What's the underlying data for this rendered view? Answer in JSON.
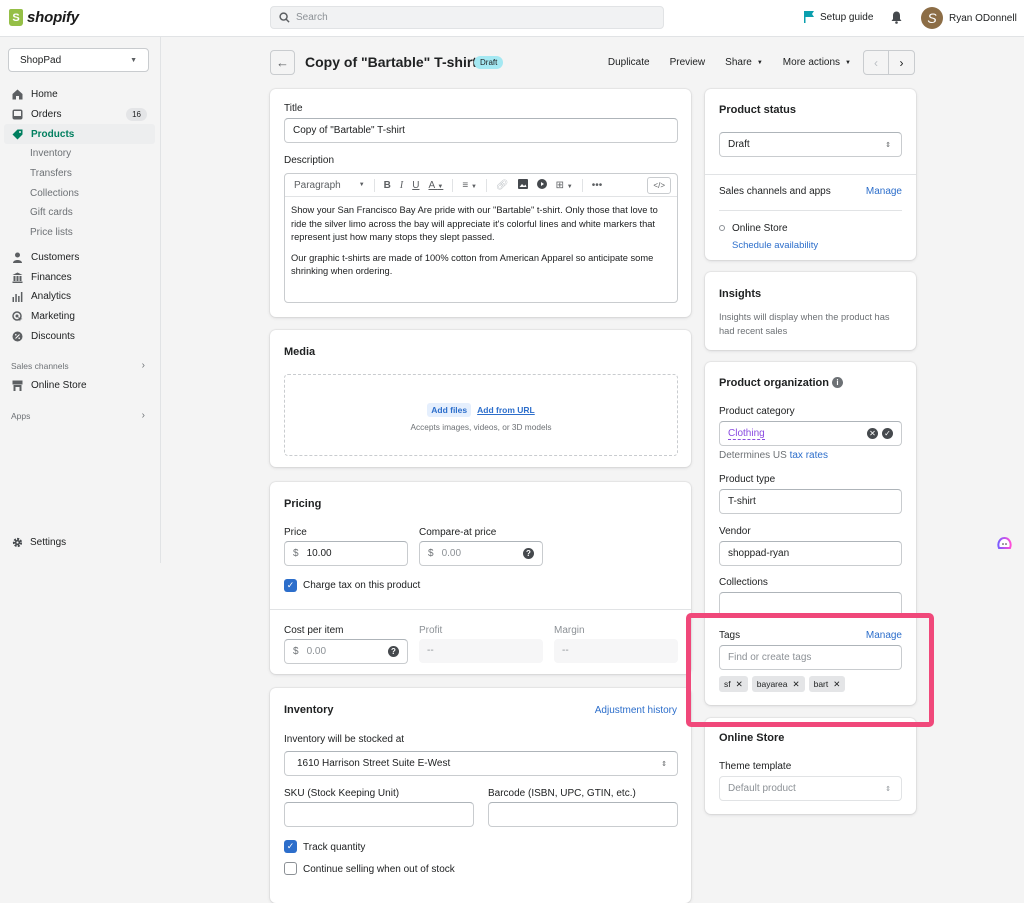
{
  "topbar": {
    "brand": "shopify",
    "search_placeholder": "Search",
    "setup_guide": "Setup guide",
    "user_initial": "S",
    "user_name": "Ryan ODonnell"
  },
  "sidebar": {
    "store_name": "ShopPad",
    "items": [
      {
        "label": "Home",
        "icon": "home-icon"
      },
      {
        "label": "Orders",
        "icon": "orders-icon",
        "badge": "16"
      },
      {
        "label": "Products",
        "icon": "tag-icon",
        "active": true
      }
    ],
    "product_sub": [
      "Inventory",
      "Transfers",
      "Collections",
      "Gift cards",
      "Price lists"
    ],
    "items2": [
      {
        "label": "Customers",
        "icon": "person-icon"
      },
      {
        "label": "Finances",
        "icon": "bank-icon"
      },
      {
        "label": "Analytics",
        "icon": "bar-chart-icon"
      },
      {
        "label": "Marketing",
        "icon": "target-icon"
      },
      {
        "label": "Discounts",
        "icon": "discount-icon"
      }
    ],
    "sales_channels_label": "Sales channels",
    "online_store": "Online Store",
    "apps_label": "Apps",
    "settings": "Settings"
  },
  "header": {
    "title": "Copy of \"Bartable\" T-shirt",
    "status_badge": "Draft",
    "actions": {
      "duplicate": "Duplicate",
      "preview": "Preview",
      "share": "Share",
      "more": "More actions"
    }
  },
  "product": {
    "title_label": "Title",
    "title_value": "Copy of \"Bartable\" T-shirt",
    "description_label": "Description",
    "toolbar_format": "Paragraph",
    "description_p1": "Show your San Francisco Bay Are pride with our \"Bartable\" t-shirt. Only those that love to ride the silver limo across the bay will appreciate it's colorful lines and white markers that represent just how many stops they slept passed.",
    "description_p2": "Our graphic t-shirts are made of 100% cotton from American Apparel so anticipate some shrinking when ordering."
  },
  "media": {
    "title": "Media",
    "add_files": "Add files",
    "add_url": "Add from URL",
    "hint": "Accepts images, videos, or 3D models"
  },
  "pricing": {
    "title": "Pricing",
    "price_label": "Price",
    "currency": "$",
    "price_value": "10.00",
    "compare_label": "Compare-at price",
    "compare_placeholder": "0.00",
    "charge_tax_label": "Charge tax on this product",
    "charge_tax_checked": true,
    "cost_label": "Cost per item",
    "cost_placeholder": "0.00",
    "profit_label": "Profit",
    "profit_value": "--",
    "margin_label": "Margin",
    "margin_value": "--"
  },
  "inventory": {
    "title": "Inventory",
    "adjustment_link": "Adjustment history",
    "location_label": "Inventory will be stocked at",
    "location_value": "1610 Harrison Street Suite E-West",
    "sku_label": "SKU (Stock Keeping Unit)",
    "sku_value": "",
    "barcode_label": "Barcode (ISBN, UPC, GTIN, etc.)",
    "barcode_value": "",
    "track_quantity": "Track quantity",
    "track_checked": true,
    "continue_selling": "Continue selling when out of stock",
    "continue_checked": false
  },
  "status": {
    "title": "Product status",
    "value": "Draft",
    "channels_title": "Sales channels and apps",
    "manage": "Manage",
    "channel": "Online Store",
    "schedule": "Schedule availability"
  },
  "insights": {
    "title": "Insights",
    "text": "Insights will display when the product has had recent sales"
  },
  "organization": {
    "title": "Product organization",
    "category_label": "Product category",
    "category_value": "Clothing",
    "category_hint": "Determines US",
    "category_hint_link": "tax rates",
    "type_label": "Product type",
    "type_value": "T-shirt",
    "vendor_label": "Vendor",
    "vendor_value": "shoppad-ryan",
    "collections_label": "Collections",
    "tags_label": "Tags",
    "tags_manage": "Manage",
    "tags_placeholder": "Find or create tags",
    "tags": [
      "sf",
      "bayarea",
      "bart"
    ]
  },
  "online_store": {
    "title": "Online Store",
    "template_label": "Theme template",
    "template_value": "Default product"
  },
  "colors": {
    "accent_green": "#007f5f",
    "link_blue": "#2c6ecb",
    "highlight_pink": "#f0487a",
    "draft_badge": "#a4e8f2"
  }
}
